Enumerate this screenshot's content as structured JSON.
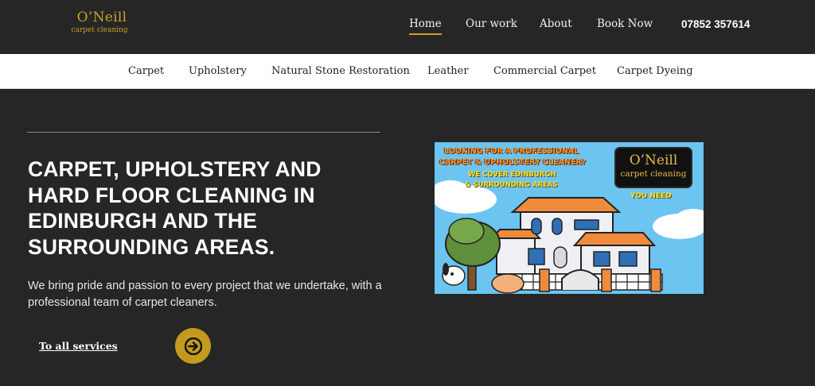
{
  "brand": {
    "name": "O’Neill",
    "tagline": "carpet cleaning"
  },
  "main_nav": [
    {
      "label": "Home",
      "active": true
    },
    {
      "label": "Our work",
      "active": false
    },
    {
      "label": "About",
      "active": false
    },
    {
      "label": "Book Now",
      "active": false
    }
  ],
  "phone": "07852 357614",
  "service_nav": [
    "Carpet",
    "Upholstery",
    "Natural Stone Restoration",
    "Leather",
    "Commercial Carpet",
    "Carpet Dyeing"
  ],
  "hero": {
    "title": "CARPET, UPHOLSTERY AND HARD FLOOR CLEANING IN EDINBURGH AND THE SURROUNDING AREAS.",
    "text": "We bring pride and passion to every project that we undertake, with a professional team of carpet cleaners.",
    "cta_label": "To all services",
    "cta_icon": "arrow-right-icon"
  },
  "promo": {
    "line1": "LOOKING FOR A PROFESSIONAL",
    "line2": "CARPET & UPHOLSTERY CLEANER?",
    "line3": "WE COVER EDINBURGH",
    "line4": "& SURROUNDING AREAS",
    "badge_name": "O’Neill",
    "badge_sub": "carpet cleaning",
    "tag": "YOU NEED"
  },
  "colors": {
    "background": "#262626",
    "accent": "#c9a227",
    "cta": "#c39a1e",
    "service_bar": "#ffffff"
  }
}
